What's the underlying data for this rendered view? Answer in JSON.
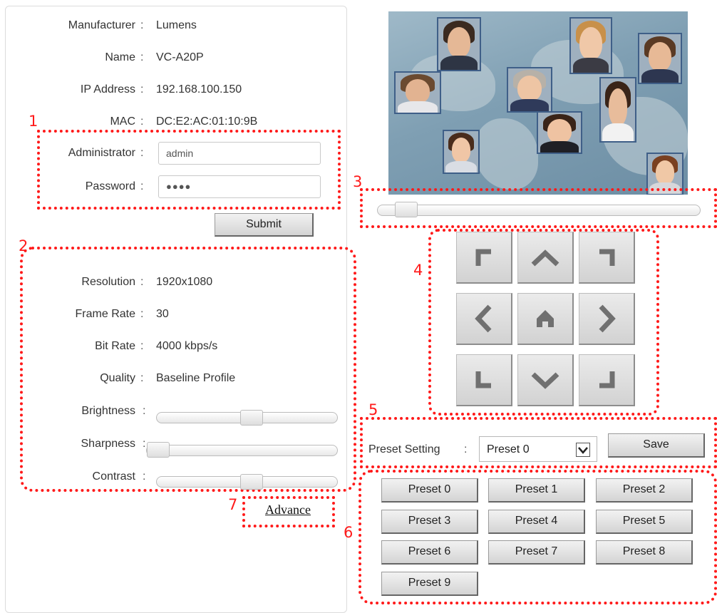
{
  "device_info": {
    "manufacturer": {
      "label": "Manufacturer",
      "value": "Lumens"
    },
    "name": {
      "label": "Name",
      "value": "VC-A20P"
    },
    "ip": {
      "label": "IP Address",
      "value": "192.168.100.150"
    },
    "mac": {
      "label": "MAC",
      "value": "DC:E2:AC:01:10:9B"
    }
  },
  "login": {
    "admin_label": "Administrator",
    "admin_value": "admin",
    "password_label": "Password",
    "password_value": "●●●●",
    "submit_label": "Submit"
  },
  "stream": {
    "resolution": {
      "label": "Resolution",
      "value": "1920x1080"
    },
    "frame_rate": {
      "label": "Frame Rate",
      "value": "30"
    },
    "bit_rate": {
      "label": "Bit Rate",
      "value": "4000 kbps/s"
    },
    "quality": {
      "label": "Quality",
      "value": "Baseline Profile"
    }
  },
  "image": {
    "brightness": {
      "label": "Brightness",
      "level": 0.53
    },
    "sharpness": {
      "label": "Sharpness",
      "level": 0.0
    },
    "contrast": {
      "label": "Contrast",
      "level": 0.53
    }
  },
  "advance_link": "Advance",
  "zoom_level": 0.04,
  "ptz": {
    "icons": [
      "up-left-icon",
      "up-icon",
      "up-right-icon",
      "left-icon",
      "home-icon",
      "right-icon",
      "down-left-icon",
      "down-icon",
      "down-right-icon"
    ]
  },
  "preset": {
    "setting_label": "Preset Setting",
    "selected": "Preset 0",
    "save_label": "Save",
    "buttons": [
      "Preset 0",
      "Preset 1",
      "Preset 2",
      "Preset 3",
      "Preset 4",
      "Preset 5",
      "Preset 6",
      "Preset 7",
      "Preset 8",
      "Preset 9"
    ]
  },
  "markers": [
    "1",
    "2",
    "3",
    "4",
    "5",
    "6",
    "7"
  ],
  "colors": {
    "annotation_red": "#ff1a1a",
    "button_gray": "#d4d4d4",
    "ptz_icon": "#707070"
  }
}
